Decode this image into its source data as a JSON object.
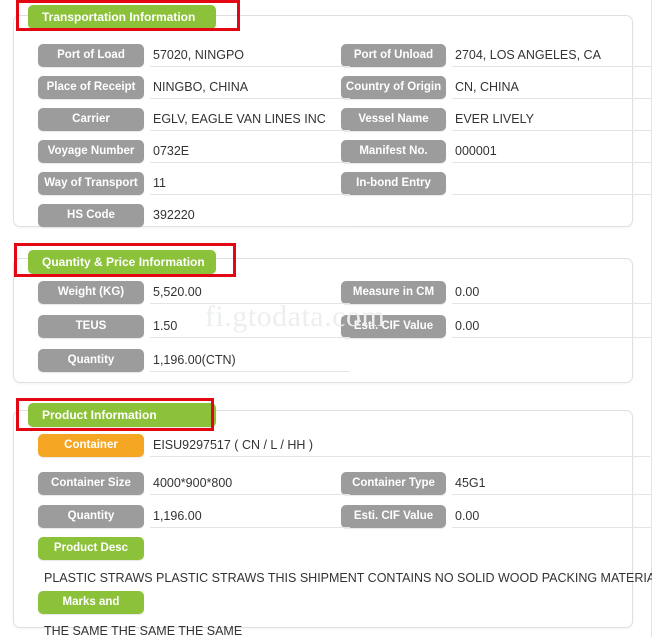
{
  "watermark": "fi.gtodata.com",
  "sections": {
    "transport": {
      "title": "Transportation Information",
      "fields_left": [
        {
          "label": "Port of Load",
          "value": "57020, NINGPO"
        },
        {
          "label": "Place of Receipt",
          "value": "NINGBO, CHINA"
        },
        {
          "label": "Carrier",
          "value": "EGLV, EAGLE VAN LINES INC"
        },
        {
          "label": "Voyage Number",
          "value": "0732E"
        },
        {
          "label": "Way of Transport",
          "value": "11"
        },
        {
          "label": "HS Code",
          "value": "392220"
        }
      ],
      "fields_right": [
        {
          "label": "Port of Unload",
          "value": "2704, LOS ANGELES, CA"
        },
        {
          "label": "Country of Origin",
          "value": "CN, CHINA"
        },
        {
          "label": "Vessel Name",
          "value": "EVER LIVELY"
        },
        {
          "label": "Manifest No.",
          "value": "000001"
        },
        {
          "label": "In-bond Entry",
          "value": ""
        }
      ]
    },
    "quantity": {
      "title": "Quantity & Price Information",
      "fields_left": [
        {
          "label": "Weight (KG)",
          "value": "5,520.00"
        },
        {
          "label": "TEUS",
          "value": "1.50"
        },
        {
          "label": "Quantity",
          "value": "1,196.00(CTN)"
        }
      ],
      "fields_right": [
        {
          "label": "Measure in CM",
          "value": "0.00"
        },
        {
          "label": "Esti. CIF Value",
          "value": "0.00"
        }
      ]
    },
    "product": {
      "title": "Product Information",
      "container": {
        "label": "Container",
        "value": "EISU9297517 ( CN / L / HH )"
      },
      "fields_left": [
        {
          "label": "Container Size",
          "value": "4000*900*800"
        },
        {
          "label": "Quantity",
          "value": "1,196.00"
        }
      ],
      "fields_right": [
        {
          "label": "Container Type",
          "value": "45G1"
        },
        {
          "label": "Esti. CIF Value",
          "value": "0.00"
        }
      ],
      "product_desc": {
        "label": "Product Desc",
        "text": "PLASTIC STRAWS PLASTIC STRAWS THIS SHIPMENT CONTAINS NO SOLID WOOD PACKING MATERIALS."
      },
      "marks": {
        "label": "Marks and",
        "text": "THE SAME THE SAME THE SAME"
      }
    }
  },
  "colors": {
    "tab_green": "#8cc23a",
    "pill_gray": "#9c9c9c",
    "pill_orange": "#f5a623",
    "annotation_red": "#e30613",
    "watermark_gray": "#eceef0"
  }
}
